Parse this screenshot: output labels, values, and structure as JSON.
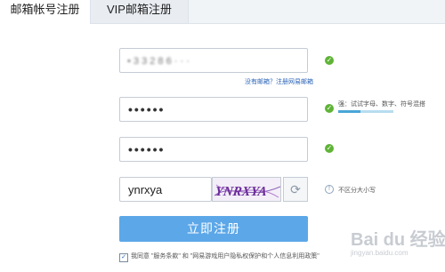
{
  "tabs": [
    {
      "label": "邮箱帐号注册",
      "active": true
    },
    {
      "label": "VIP邮箱注册",
      "active": false
    }
  ],
  "email": {
    "value": "............",
    "blurred_display": "• 3 3 2 8 6 ·      ·    ·  "
  },
  "no_mailbox_link": "没有邮箱？注册网易邮箱",
  "password": {
    "value": "••••••",
    "strength_hint": "强：试试字母、数字、符号混搭",
    "strength_level": 0.4
  },
  "confirm_password": {
    "value": "••••••"
  },
  "captcha": {
    "value": "ynrxya",
    "image_text": "YNRXYA",
    "hint": "不区分大小写"
  },
  "submit_label": "立即注册",
  "agreement": {
    "checked": true,
    "text": "我同意 \"服务条款\" 和 \"网易游戏用户隐私权保护和个人信息利用政策\""
  },
  "watermark": {
    "main": "Bai du 经验",
    "sub": "jingyan.baidu.com"
  },
  "colors": {
    "accent": "#5ca7e8",
    "success": "#5fb336",
    "link": "#2a63b7"
  }
}
